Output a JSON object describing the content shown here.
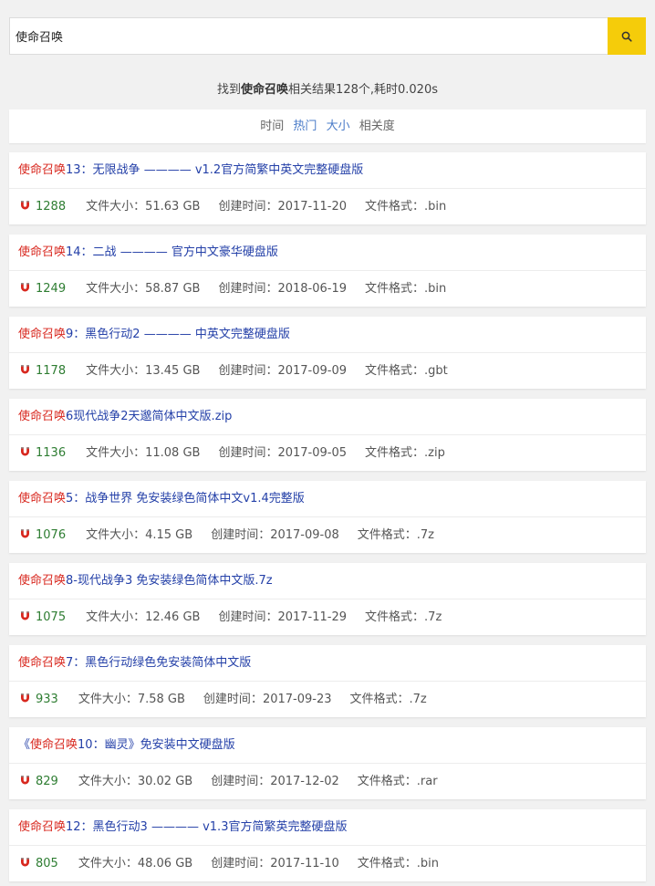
{
  "search": {
    "query": "使命召唤",
    "button_icon": "search-icon"
  },
  "summary": {
    "prefix": "找到",
    "keyword": "使命召唤",
    "suffix": "相关结果128个,耗时0.020s"
  },
  "sort": {
    "options": [
      {
        "label": "时间",
        "active": false
      },
      {
        "label": "热门",
        "active": true
      },
      {
        "label": "大小",
        "active": true
      },
      {
        "label": "相关度",
        "active": false
      }
    ]
  },
  "labels": {
    "size": "文件大小：",
    "created": "创建时间：",
    "format": "文件格式："
  },
  "colors": {
    "accent": "#f5cc0a",
    "highlight": "#d8281f",
    "title_link": "#2440a8",
    "heat": "#2e7d32",
    "magnet": "#d8281f"
  },
  "results": [
    {
      "hl": "使命召唤",
      "rest": "13：无限战争 ———— v1.2官方简繁中英文完整硬盘版",
      "heat": "1288",
      "size": "51.63 GB",
      "created": "2017-11-20",
      "format": ".bin"
    },
    {
      "hl": "使命召唤",
      "rest": "14：二战 ———— 官方中文豪华硬盘版",
      "heat": "1249",
      "size": "58.87 GB",
      "created": "2018-06-19",
      "format": ".bin"
    },
    {
      "hl": "使命召唤",
      "rest": "9：黑色行动2 ———— 中英文完整硬盘版",
      "heat": "1178",
      "size": "13.45 GB",
      "created": "2017-09-09",
      "format": ".gbt"
    },
    {
      "hl": "使命召唤",
      "rest": "6现代战争2天邈简体中文版.zip",
      "heat": "1136",
      "size": "11.08 GB",
      "created": "2017-09-05",
      "format": ".zip"
    },
    {
      "hl": "使命召唤",
      "rest": "5：战争世界 免安装绿色简体中文v1.4完整版",
      "heat": "1076",
      "size": "4.15 GB",
      "created": "2017-09-08",
      "format": ".7z"
    },
    {
      "hl": "使命召唤",
      "rest": "8-现代战争3 免安装绿色简体中文版.7z",
      "heat": "1075",
      "size": "12.46 GB",
      "created": "2017-11-29",
      "format": ".7z"
    },
    {
      "hl": "使命召唤",
      "rest": "7：黑色行动绿色免安装简体中文版",
      "heat": "933",
      "size": "7.58 GB",
      "created": "2017-09-23",
      "format": ".7z"
    },
    {
      "pre": "《",
      "hl": "使命召唤",
      "rest": "10：幽灵》免安装中文硬盘版",
      "heat": "829",
      "size": "30.02 GB",
      "created": "2017-12-02",
      "format": ".rar"
    },
    {
      "hl": "使命召唤",
      "rest": "12：黑色行动3 ———— v1.3官方简繁英完整硬盘版",
      "heat": "805",
      "size": "48.06 GB",
      "created": "2017-11-10",
      "format": ".bin"
    }
  ]
}
